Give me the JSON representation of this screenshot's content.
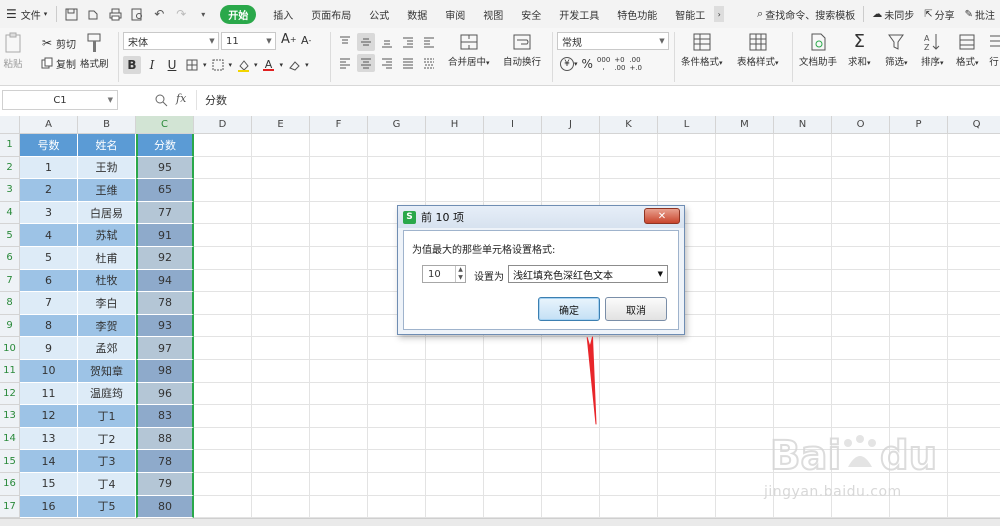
{
  "menubar": {
    "file_label": "文件",
    "tabs": [
      {
        "label": "开始",
        "active": true
      },
      {
        "label": "插入"
      },
      {
        "label": "页面布局"
      },
      {
        "label": "公式"
      },
      {
        "label": "数据"
      },
      {
        "label": "审阅"
      },
      {
        "label": "视图"
      },
      {
        "label": "安全"
      },
      {
        "label": "开发工具"
      },
      {
        "label": "特色功能"
      },
      {
        "label": "智能工"
      }
    ],
    "search_label": "查找命令、搜索模板",
    "sync_label": "未同步",
    "share_label": "分享",
    "comment_label": "批注"
  },
  "ribbon": {
    "paste": "粘贴",
    "cut": "剪切",
    "copy": "复制",
    "format_painter": "格式刷",
    "font_name": "宋体",
    "font_size": "11",
    "merge_center": "合并居中",
    "wrap_text": "自动换行",
    "number_format": "常规",
    "currency_symbol": "¥",
    "percent_symbol": "%",
    "thousands_sep": "000",
    "dec_increase_top": "+0",
    "dec_increase_bottom": ".00",
    "dec_decrease_top": ".00",
    "dec_decrease_bottom": "+.0",
    "conditional_format": "条件格式",
    "table_style": "表格样式",
    "doc_assistant": "文档助手",
    "sum": "求和",
    "filter": "筛选",
    "sort": "排序",
    "format": "格式",
    "rows": "行"
  },
  "formula_bar": {
    "cell_ref": "C1",
    "fx": "fx",
    "content": "分数"
  },
  "columns": [
    "A",
    "B",
    "C",
    "D",
    "E",
    "F",
    "G",
    "H",
    "I",
    "J",
    "K",
    "L",
    "M",
    "N",
    "O",
    "P",
    "Q"
  ],
  "rows": [
    "1",
    "2",
    "3",
    "4",
    "5",
    "6",
    "7",
    "8",
    "9",
    "10",
    "11",
    "12",
    "13",
    "14",
    "15",
    "16",
    "17"
  ],
  "table": {
    "headers": [
      "号数",
      "姓名",
      "分数"
    ],
    "data": [
      [
        "1",
        "王勃",
        "95"
      ],
      [
        "2",
        "王维",
        "65"
      ],
      [
        "3",
        "白居易",
        "77"
      ],
      [
        "4",
        "苏轼",
        "91"
      ],
      [
        "5",
        "杜甫",
        "92"
      ],
      [
        "6",
        "杜牧",
        "94"
      ],
      [
        "7",
        "李白",
        "78"
      ],
      [
        "8",
        "李贺",
        "93"
      ],
      [
        "9",
        "孟郊",
        "97"
      ],
      [
        "10",
        "贺知章",
        "98"
      ],
      [
        "11",
        "温庭筠",
        "96"
      ],
      [
        "12",
        "丁1",
        "83"
      ],
      [
        "13",
        "丁2",
        "88"
      ],
      [
        "14",
        "丁3",
        "78"
      ],
      [
        "15",
        "丁4",
        "79"
      ],
      [
        "16",
        "丁5",
        "80"
      ]
    ]
  },
  "dialog": {
    "title": "前 10 项",
    "description": "为值最大的那些单元格设置格式:",
    "count_value": "10",
    "set_as_label": "设置为",
    "format_option": "浅红填充色深红色文本",
    "ok_label": "确定",
    "cancel_label": "取消"
  },
  "watermark": {
    "brand": "Baidu经验",
    "url": "jingyan.baidu.com"
  },
  "colors": {
    "accent_green": "#2aa84a",
    "header_fill": "#5b9bd5",
    "band_light": "#ddebf7",
    "band_dark": "#9dc3e6",
    "col_c_light": "#b4c6d6",
    "col_c_dark": "#8eaacb",
    "arrow_red": "#e8262b"
  }
}
